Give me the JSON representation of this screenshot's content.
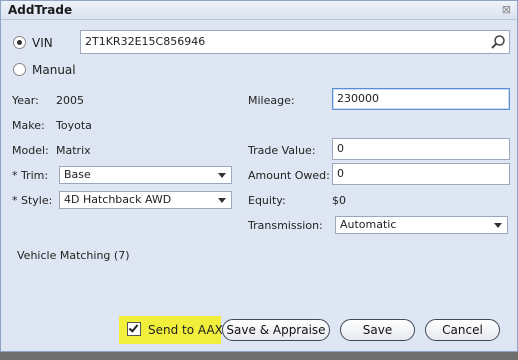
{
  "dialog": {
    "title": "AddTrade",
    "close_glyph": "⊠"
  },
  "vin": {
    "option_label": "VIN",
    "selected": true,
    "value": "2T1KR32E15C856946"
  },
  "manual": {
    "option_label": "Manual",
    "selected": false
  },
  "vehicle": {
    "year_label": "Year:",
    "year": "2005",
    "make_label": "Make:",
    "make": "Toyota",
    "model_label": "Model:",
    "model": "Matrix",
    "trim_label": "* Trim:",
    "trim": "Base",
    "style_label": "* Style:",
    "style": "4D Hatchback AWD"
  },
  "financials": {
    "mileage_label": "Mileage:",
    "mileage": "230000",
    "trade_value_label": "Trade Value:",
    "trade_value": "0",
    "amount_owed_label": "Amount Owed:",
    "amount_owed": "0",
    "equity_label": "Equity:",
    "equity": "$0",
    "transmission_label": "Transmission:",
    "transmission": "Automatic"
  },
  "matching": {
    "label": "Vehicle Matching",
    "count": "(7)"
  },
  "footer": {
    "send_to_aax_label": "Send to AAX",
    "send_to_aax_checked": true,
    "save_appraise_label": "Save & Appraise",
    "save_label": "Save",
    "cancel_label": "Cancel"
  },
  "colors": {
    "highlight": "#f2ef3c",
    "dialog_bg": "#dfe6f3"
  }
}
